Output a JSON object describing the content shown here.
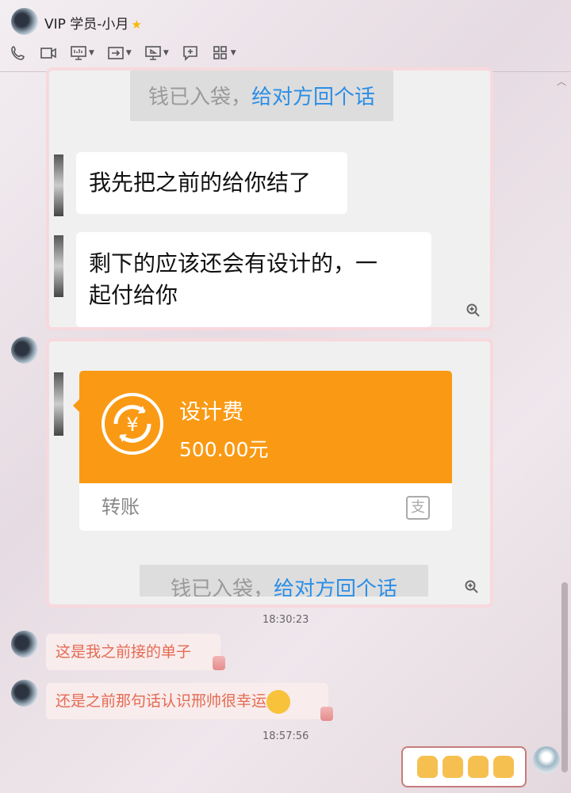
{
  "header": {
    "title": "VIP 学员-小月",
    "toolbar": [
      "phone-icon",
      "video-icon",
      "screen-share-icon",
      "transfer-file-icon",
      "remote-desktop-icon",
      "comment-icon",
      "apps-icon"
    ]
  },
  "panel1": {
    "ack_prefix": "钱已入袋，",
    "ack_link": "给对方回个话",
    "msg1": "我先把之前的给你结了",
    "msg2_line1": "剩下的应该还会有设计的，一",
    "msg2_line2": "起付给你"
  },
  "panel2": {
    "transfer": {
      "title": "设计费",
      "amount": "500.00元",
      "footer": "转账",
      "brand": "支",
      "accent": "#fa9a14"
    },
    "ack_prefix": "钱已入袋，",
    "ack_link": "给对方回个话"
  },
  "time1": "18:30:23",
  "msg3": "这是我之前接的单子",
  "msg4": "还是之前那句话认识邢帅很幸运",
  "time2": "18:57:56",
  "colors": {
    "bubble_text": "#e46a52",
    "link": "#2b8ee6",
    "panel_border": "#f7d9dd"
  }
}
